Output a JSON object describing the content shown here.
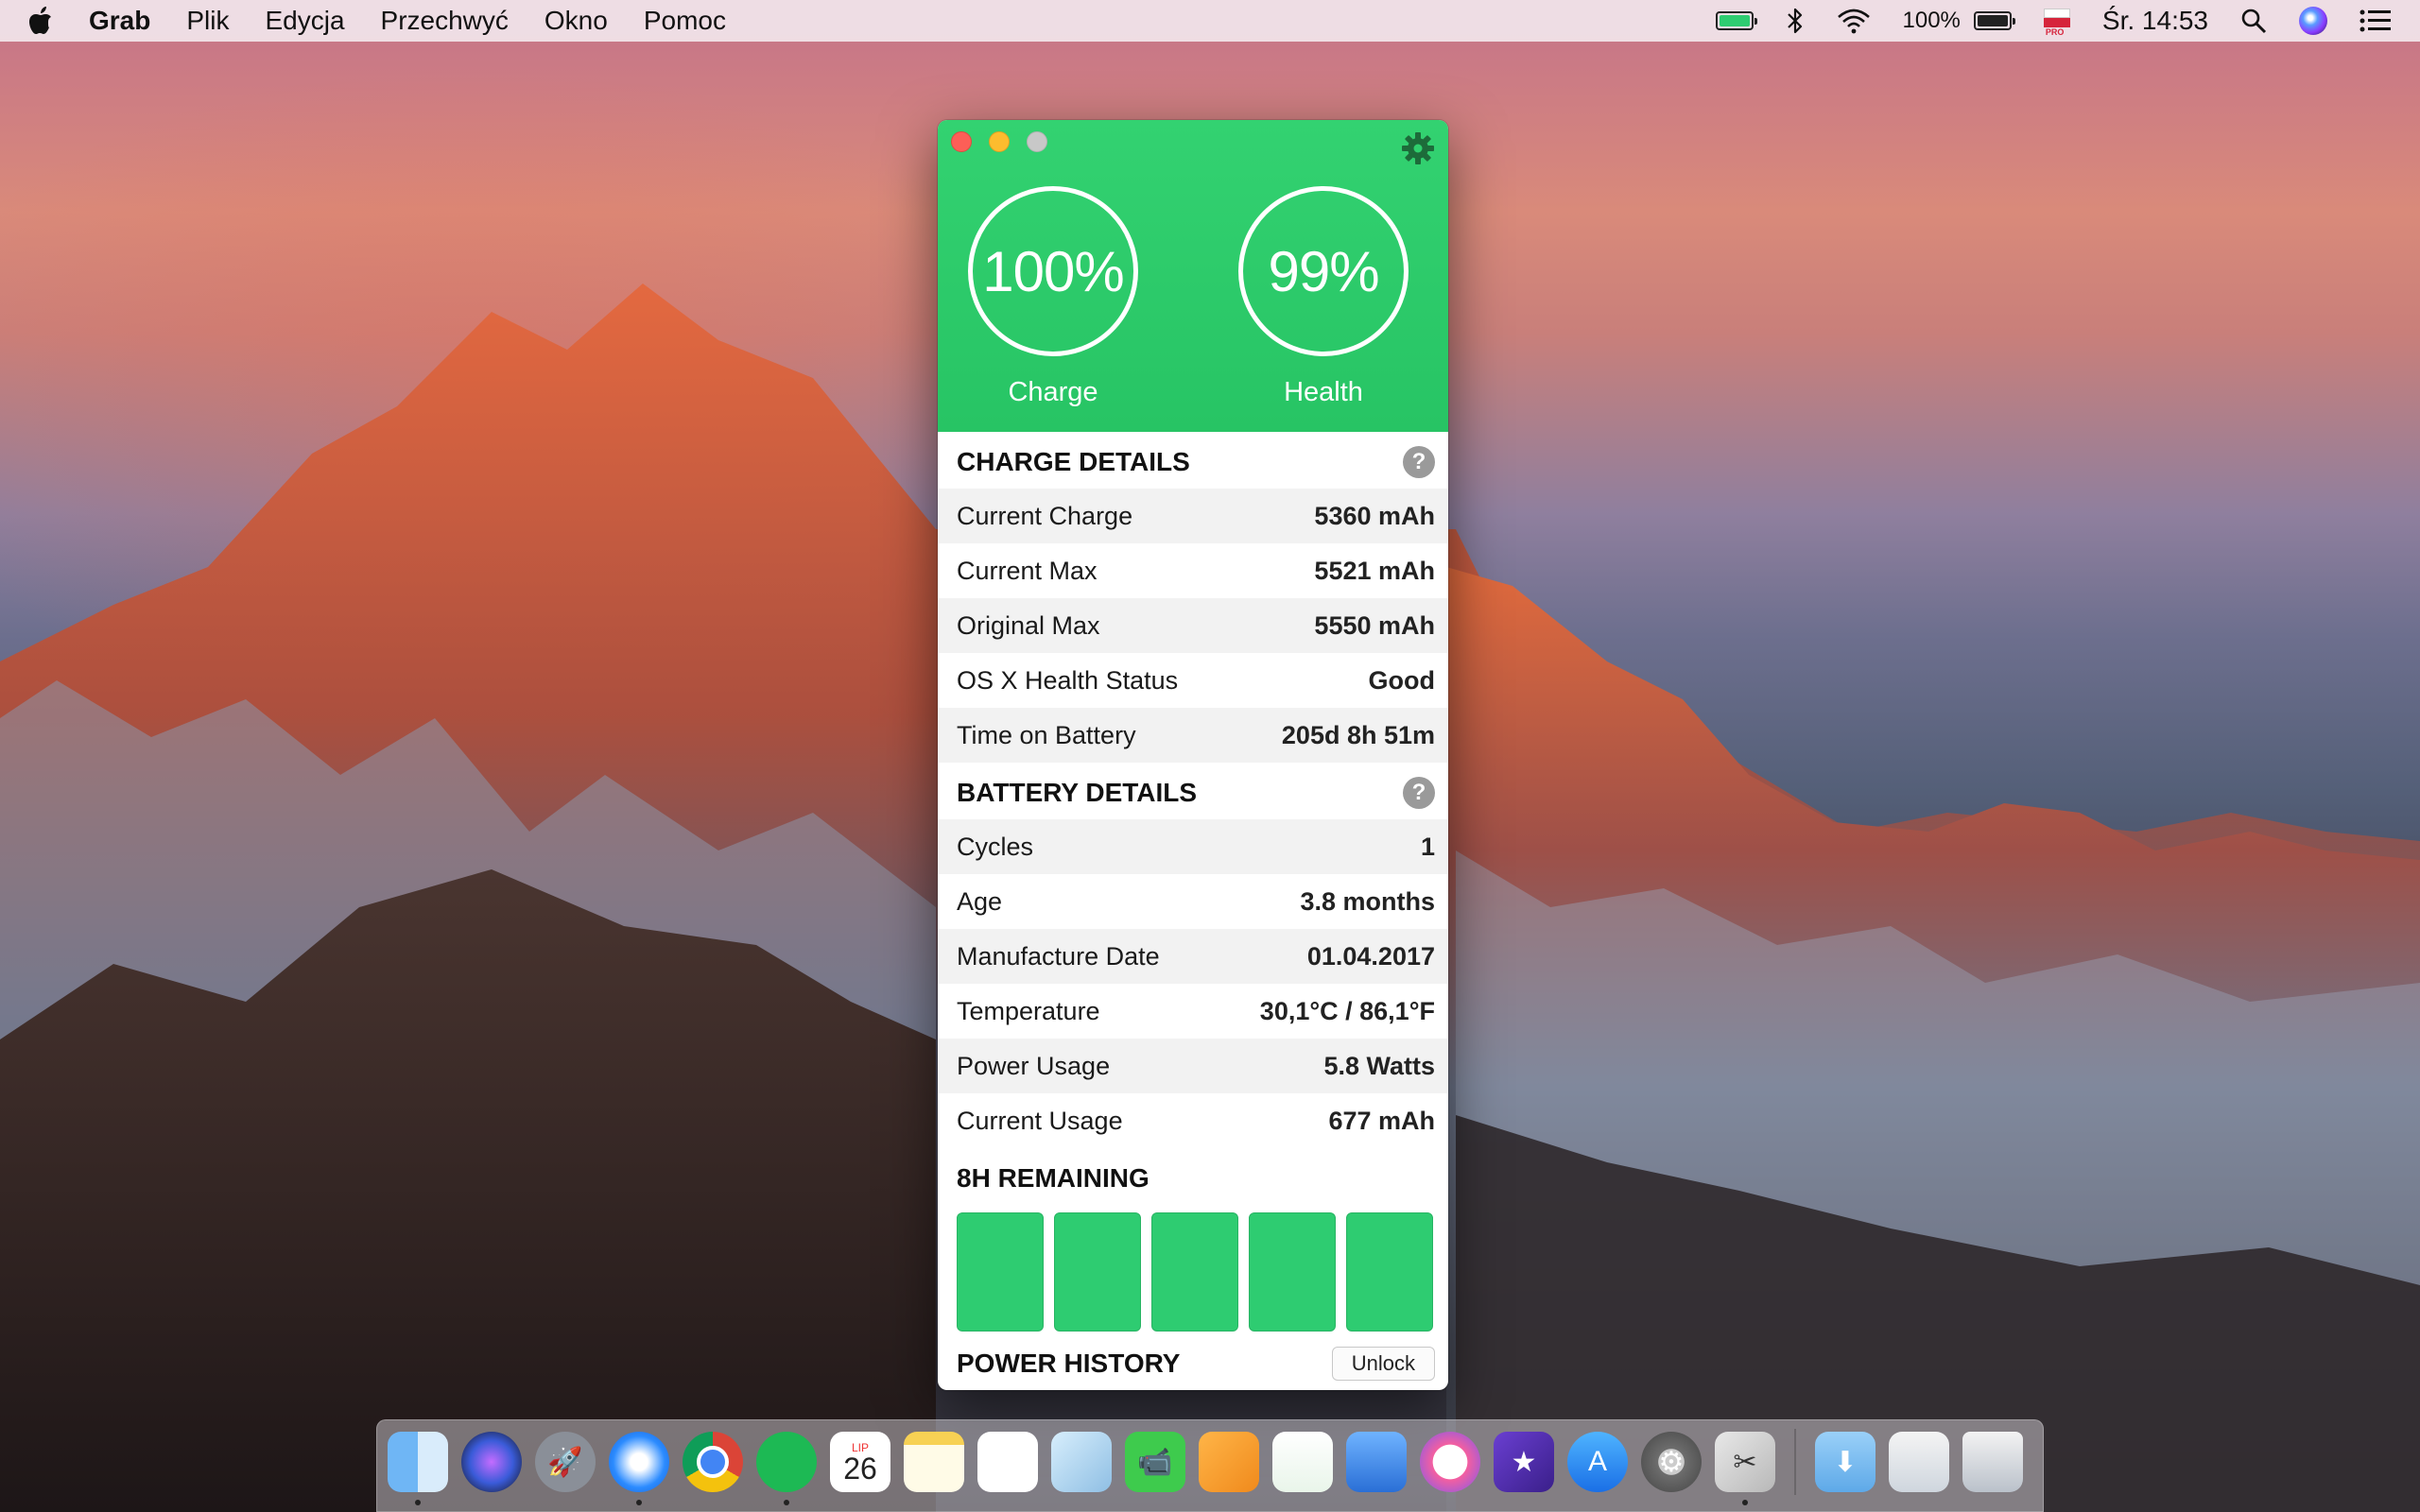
{
  "menubar": {
    "app_name": "Grab",
    "menus": [
      "Plik",
      "Edycja",
      "Przechwyć",
      "Okno",
      "Pomoc"
    ],
    "status": {
      "battery_percent": "100%",
      "flag_badge": "PRO",
      "clock": "Śr. 14:53"
    },
    "icons": [
      "apple-icon",
      "battery-app-icon",
      "bluetooth-icon",
      "wifi-icon",
      "battery-icon",
      "input-flag-icon",
      "spotlight-search-icon",
      "siri-icon",
      "notification-center-icon"
    ]
  },
  "colors": {
    "accent_green": "#2ecc71",
    "close": "#fc5f57",
    "minimize": "#fdbc2e",
    "zoom_inactive": "#c8c8c8"
  },
  "hero": {
    "charge_value": "100%",
    "charge_label": "Charge",
    "health_value": "99%",
    "health_label": "Health"
  },
  "charge_details": {
    "title": "CHARGE DETAILS",
    "help": "?",
    "rows": [
      {
        "label": "Current Charge",
        "value": "5360 mAh"
      },
      {
        "label": "Current Max",
        "value": "5521 mAh"
      },
      {
        "label": "Original Max",
        "value": "5550 mAh"
      },
      {
        "label": "OS X Health Status",
        "value": "Good"
      },
      {
        "label": "Time on Battery",
        "value": "205d 8h 51m"
      }
    ]
  },
  "battery_details": {
    "title": "BATTERY DETAILS",
    "help": "?",
    "rows": [
      {
        "label": "Cycles",
        "value": "1"
      },
      {
        "label": "Age",
        "value": "3.8 months"
      },
      {
        "label": "Manufacture Date",
        "value": "01.04.2017"
      },
      {
        "label": "Temperature",
        "value": "30,1°C / 86,1°F"
      },
      {
        "label": "Power Usage",
        "value": "5.8 Watts"
      },
      {
        "label": "Current Usage",
        "value": "677 mAh"
      }
    ]
  },
  "remaining": {
    "title": "8H REMAINING",
    "bars_filled": 5,
    "bars_total": 5
  },
  "power_history": {
    "title": "POWER HISTORY",
    "unlock_label": "Unlock"
  },
  "dock": {
    "calendar_month": "LIP",
    "calendar_day": "26",
    "apps": [
      "finder",
      "siri",
      "launchpad",
      "safari",
      "chrome",
      "spotify",
      "calendar",
      "notes",
      "reminders",
      "preview",
      "facetime",
      "pages",
      "numbers",
      "keynote",
      "itunes",
      "imovie",
      "app-store",
      "system-preferences",
      "grab",
      "downloads",
      "documents",
      "trash"
    ]
  }
}
